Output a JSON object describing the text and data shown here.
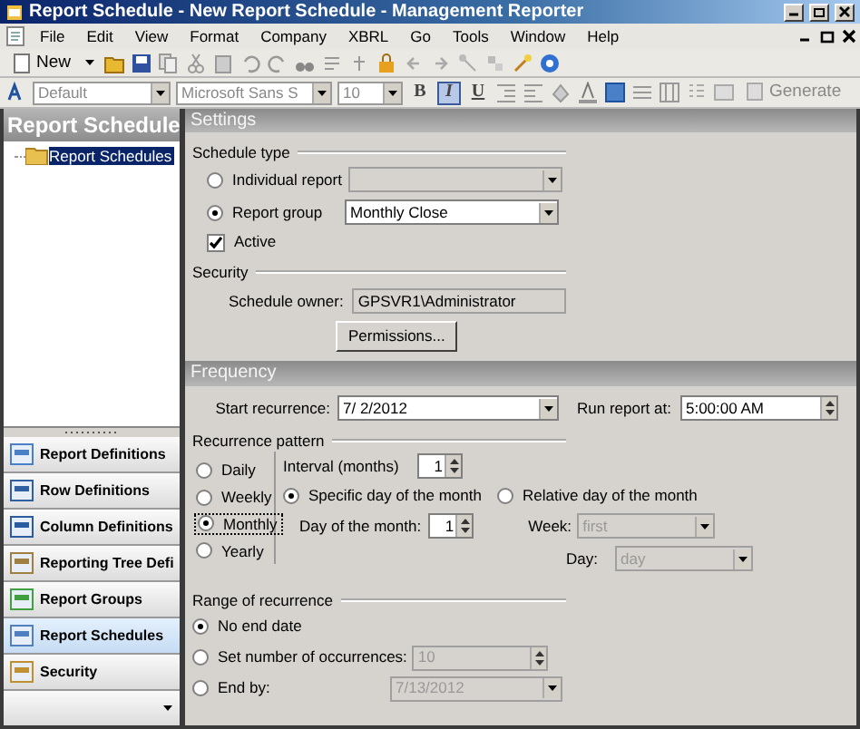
{
  "window": {
    "title": "Report Schedule - New Report Schedule - Management Reporter"
  },
  "menu": [
    {
      "label": "File"
    },
    {
      "label": "Edit"
    },
    {
      "label": "View"
    },
    {
      "label": "Format"
    },
    {
      "label": "Company"
    },
    {
      "label": "XBRL"
    },
    {
      "label": "Go"
    },
    {
      "label": "Tools"
    },
    {
      "label": "Window"
    },
    {
      "label": "Help"
    }
  ],
  "toolbar": {
    "new_label": "New"
  },
  "format_bar": {
    "style": "Default",
    "font": "Microsoft Sans S",
    "size": "10",
    "generate": "Generate",
    "styles": [
      {
        "label": "B",
        "selected": false
      },
      {
        "label": "I",
        "selected": true
      },
      {
        "label": "U",
        "selected": false
      }
    ]
  },
  "sidebar": {
    "title": "Report Schedule",
    "tree": [
      {
        "label": "Report Schedules",
        "selected": true
      }
    ],
    "nav": [
      {
        "label": "Report Definitions",
        "selected": false
      },
      {
        "label": "Row Definitions",
        "selected": false
      },
      {
        "label": "Column Definitions",
        "selected": false
      },
      {
        "label": "Reporting Tree Defi",
        "selected": false
      },
      {
        "label": "Report Groups",
        "selected": false
      },
      {
        "label": "Report Schedules",
        "selected": true
      },
      {
        "label": "Security",
        "selected": false
      }
    ]
  },
  "settings": {
    "title": "Settings",
    "schedule_type_label": "Schedule type",
    "schedule_types": [
      {
        "label": "Individual report",
        "selected": false,
        "disabled": true
      },
      {
        "label": "Report group",
        "selected": true,
        "value": "Monthly Close",
        "disabled": false
      }
    ],
    "active": {
      "label": "Active",
      "checked": true
    },
    "security_label": "Security",
    "owner_label": "Schedule owner:",
    "owner_value": "GPSVR1\\Administrator",
    "permissions_button": "Permissions..."
  },
  "frequency": {
    "title": "Frequency",
    "start_label": "Start recurrence:",
    "start_value": "7/ 2/2012",
    "run_label": "Run report at:",
    "run_value": "5:00:00 AM",
    "pattern_label": "Recurrence pattern",
    "patterns": [
      {
        "label": "Daily",
        "selected": false
      },
      {
        "label": "Weekly",
        "selected": false
      },
      {
        "label": "Monthly",
        "selected": true
      },
      {
        "label": "Yearly",
        "selected": false
      }
    ],
    "interval_label": "Interval (months)",
    "interval_value": "1",
    "specific": {
      "label": "Specific day of the month",
      "selected": true
    },
    "day_label": "Day of the month:",
    "day_value": "1",
    "relative": {
      "label": "Relative day of the month",
      "selected": false
    },
    "week_label": "Week:",
    "week_value": "first",
    "weekday_label": "Day:",
    "weekday_value": "day"
  },
  "range": {
    "label": "Range of recurrence",
    "options": [
      {
        "label": "No end date",
        "selected": true
      },
      {
        "label": "Set number of occurrences:",
        "selected": false,
        "kind": "spinner",
        "value": "10"
      },
      {
        "label": "End by:",
        "selected": false,
        "kind": "dropdown",
        "value": "7/13/2012"
      }
    ]
  }
}
